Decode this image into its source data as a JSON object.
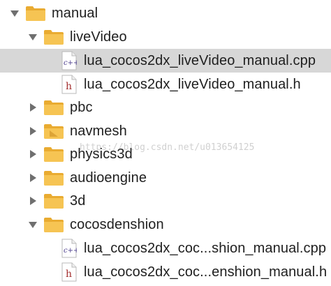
{
  "tree": {
    "root": {
      "label": "manual",
      "expanded": true
    },
    "liveVideo": {
      "label": "liveVideo",
      "expanded": true,
      "files": [
        {
          "label": "lua_cocos2dx_liveVideo_manual.cpp",
          "type": "cpp",
          "icon": "c++",
          "selected": true
        },
        {
          "label": "lua_cocos2dx_liveVideo_manual.h",
          "type": "h",
          "icon": "h",
          "selected": false
        }
      ]
    },
    "folders": [
      {
        "label": "pbc",
        "expanded": false
      },
      {
        "label": "navmesh",
        "expanded": false
      },
      {
        "label": "physics3d",
        "expanded": false
      },
      {
        "label": "audioengine",
        "expanded": false
      },
      {
        "label": "3d",
        "expanded": false
      }
    ],
    "cocosdenshion": {
      "label": "cocosdenshion",
      "expanded": true,
      "files": [
        {
          "label": "lua_cocos2dx_coc...shion_manual.cpp",
          "type": "cpp",
          "icon": "c++"
        },
        {
          "label": "lua_cocos2dx_coc...enshion_manual.h",
          "type": "h",
          "icon": "h"
        }
      ]
    }
  },
  "watermark": "https://blog.csdn.net/u013654125",
  "colors": {
    "folder": "#f6c453",
    "folder_dark": "#e9ab31",
    "selection": "#d7d7d7",
    "text": "#1f1f1f",
    "arrow": "#6f6f6f"
  },
  "icons": {
    "expanded": "triangle-down-icon",
    "collapsed": "triangle-right-icon",
    "folder": "folder-icon",
    "cpp_file": "cpp-file-icon",
    "h_file": "header-file-icon"
  }
}
